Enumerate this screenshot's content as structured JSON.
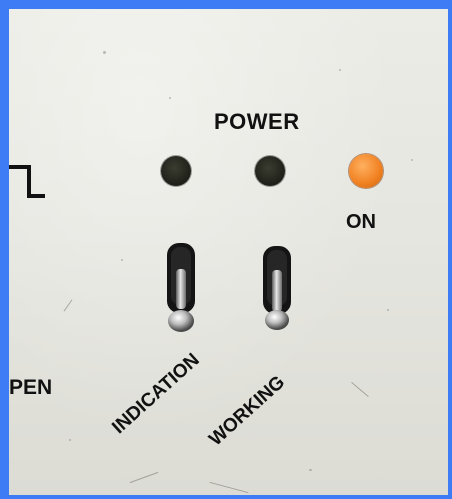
{
  "panel": {
    "power_label": "POWER",
    "on_label": "ON",
    "pen_label": "PEN",
    "switch_labels": [
      "INDICATION",
      "WORKING"
    ]
  },
  "indicators": [
    {
      "state": "off",
      "color": "#25261e"
    },
    {
      "state": "off",
      "color": "#25261e"
    },
    {
      "state": "on",
      "color": "#f08020"
    }
  ],
  "frame_color": "#3d7cf5",
  "icons": [
    "square-wave-icon"
  ]
}
